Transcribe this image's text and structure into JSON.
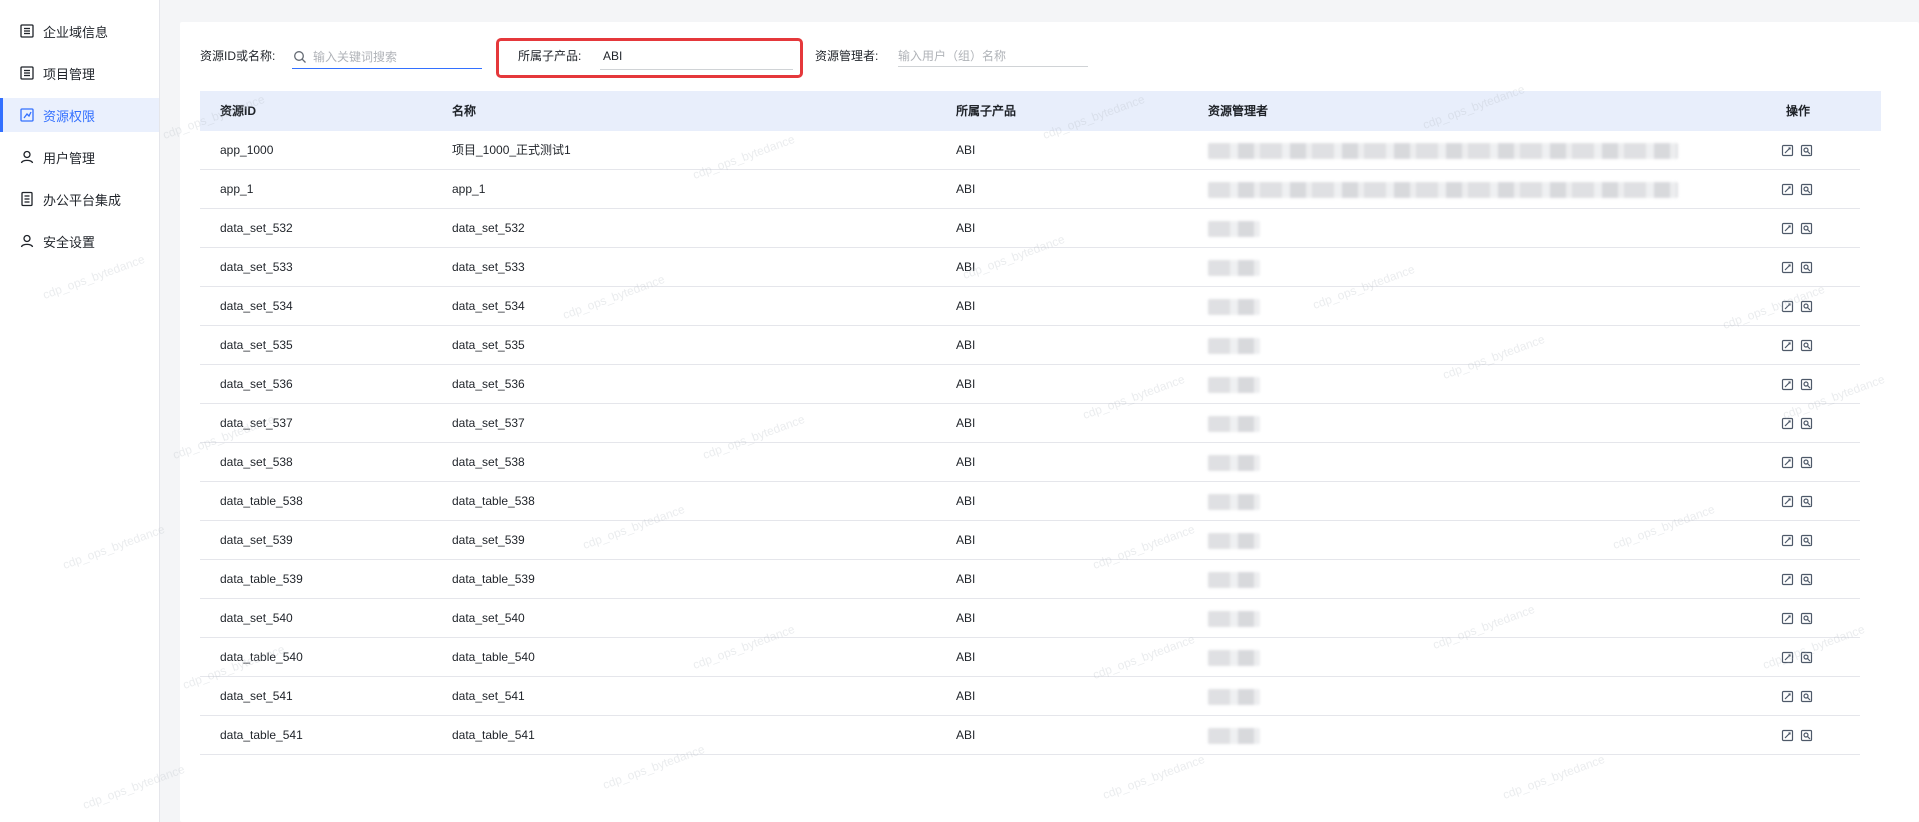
{
  "sidebar": {
    "items": [
      {
        "label": "企业域信息",
        "icon": "list-icon"
      },
      {
        "label": "项目管理",
        "icon": "list-icon"
      },
      {
        "label": "资源权限",
        "icon": "resource-icon",
        "active": true
      },
      {
        "label": "用户管理",
        "icon": "user-icon"
      },
      {
        "label": "办公平台集成",
        "icon": "document-icon"
      },
      {
        "label": "安全设置",
        "icon": "user-icon"
      }
    ]
  },
  "filters": {
    "resource_label": "资源ID或名称:",
    "resource_placeholder": "输入关键词搜索",
    "product_label": "所属子产品:",
    "product_value": "ABI",
    "manager_label": "资源管理者:",
    "manager_placeholder": "输入用户（组）名称"
  },
  "table": {
    "columns": {
      "id": "资源ID",
      "name": "名称",
      "product": "所属子产品",
      "manager": "资源管理者",
      "ops": "操作"
    },
    "rows": [
      {
        "id": "app_1000",
        "name": "项目_1000_正式测试1",
        "product": "ABI"
      },
      {
        "id": "app_1",
        "name": "app_1",
        "product": "ABI"
      },
      {
        "id": "data_set_532",
        "name": "data_set_532",
        "product": "ABI"
      },
      {
        "id": "data_set_533",
        "name": "data_set_533",
        "product": "ABI"
      },
      {
        "id": "data_set_534",
        "name": "data_set_534",
        "product": "ABI"
      },
      {
        "id": "data_set_535",
        "name": "data_set_535",
        "product": "ABI"
      },
      {
        "id": "data_set_536",
        "name": "data_set_536",
        "product": "ABI"
      },
      {
        "id": "data_set_537",
        "name": "data_set_537",
        "product": "ABI"
      },
      {
        "id": "data_set_538",
        "name": "data_set_538",
        "product": "ABI"
      },
      {
        "id": "data_table_538",
        "name": "data_table_538",
        "product": "ABI"
      },
      {
        "id": "data_set_539",
        "name": "data_set_539",
        "product": "ABI"
      },
      {
        "id": "data_table_539",
        "name": "data_table_539",
        "product": "ABI"
      },
      {
        "id": "data_set_540",
        "name": "data_set_540",
        "product": "ABI"
      },
      {
        "id": "data_table_540",
        "name": "data_table_540",
        "product": "ABI"
      },
      {
        "id": "data_set_541",
        "name": "data_set_541",
        "product": "ABI"
      },
      {
        "id": "data_table_541",
        "name": "data_table_541",
        "product": "ABI"
      }
    ]
  },
  "watermark_text": "cdp_ops_bytedance",
  "colors": {
    "accent": "#3370ff",
    "highlight": "#e5383b",
    "header_bg": "#e8eefb"
  }
}
